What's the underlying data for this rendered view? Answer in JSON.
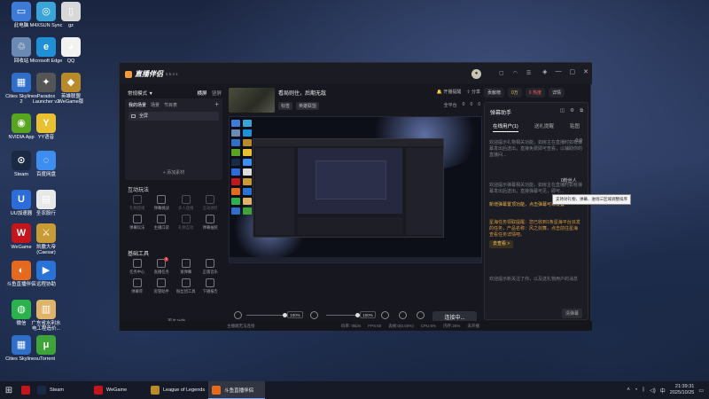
{
  "desktop": {
    "icons": [
      {
        "label": "此电脑",
        "color": "#3d7bd6",
        "glyph": "▭"
      },
      {
        "label": "M4XSUN Sync",
        "color": "#3aa4d8",
        "glyph": "◎"
      },
      {
        "label": "gz",
        "color": "#d8d8d8",
        "glyph": "▯"
      },
      {
        "label": "回收站",
        "color": "#6a8ab3",
        "glyph": "♲"
      },
      {
        "label": "Microsoft Edge",
        "color": "#1f8fd6",
        "glyph": "e"
      },
      {
        "label": "QQ",
        "color": "#f2f2f2",
        "glyph": "◕"
      },
      {
        "label": "Cities Skylines 2",
        "color": "#2f6fc8",
        "glyph": "▦"
      },
      {
        "label": "Paradox Launcher v2",
        "color": "#555",
        "glyph": "✦"
      },
      {
        "label": "英雄联盟 WeGame版",
        "color": "#b88a2a",
        "glyph": "◆"
      },
      {
        "label": "NVIDIA App",
        "color": "#58a520",
        "glyph": "◉"
      },
      {
        "label": "YY语音",
        "color": "#e9c02f",
        "glyph": "Y"
      },
      {
        "label": "Steam",
        "color": "#1b2a44",
        "glyph": "⊙"
      },
      {
        "label": "百度网盘",
        "color": "#3d8ef0",
        "glyph": "◌"
      },
      {
        "label": "UU加速器",
        "color": "#2b6cd9",
        "glyph": "U"
      },
      {
        "label": "圣农股行",
        "color": "#e8e8e8",
        "glyph": "▤"
      },
      {
        "label": "WeGame",
        "color": "#c4141c",
        "glyph": "W"
      },
      {
        "label": "凯撒大帝 (Caesar)",
        "color": "#c99b35",
        "glyph": "⚔"
      },
      {
        "label": "斗鱼直播伴侣",
        "color": "#e56a20",
        "glyph": "◐"
      },
      {
        "label": "远程协助",
        "color": "#2a73d6",
        "glyph": "▶"
      },
      {
        "label": "微信",
        "color": "#2bb24c",
        "glyph": "◍"
      },
      {
        "label": "广东省水利水电工程造价...",
        "color": "#e0b36a",
        "glyph": "▥"
      },
      {
        "label": "Cities Skylines",
        "color": "#2f6fc8",
        "glyph": "▦"
      },
      {
        "label": "uTorrent",
        "color": "#3ea43a",
        "glyph": "μ"
      }
    ]
  },
  "taskbar": {
    "start_icon": "windows-icon",
    "items": [
      {
        "label": "",
        "color": "#c4141c"
      },
      {
        "label": "Steam",
        "color": "#1b2a44"
      },
      {
        "label": "WeGame",
        "color": "#c4141c"
      },
      {
        "label": "League of Legends",
        "color": "#b88a2a"
      },
      {
        "label": "斗鱼直播伴侣",
        "color": "#e56a20"
      }
    ],
    "active_index": 4,
    "tray": {
      "time": "21:39:31",
      "date": "2025/10/25",
      "lang": "中"
    }
  },
  "app": {
    "logo_text": "直播伴侣",
    "version": "6.5.2.1",
    "avatar_text": "●",
    "left": {
      "mode_label": "常规模式",
      "mode_arrow": "▼",
      "tabs": [
        "横屏",
        "竖屏"
      ],
      "scene_tabs": [
        "我的场景",
        "场景",
        "节目表"
      ],
      "scene_item": "全屏",
      "add_source": "+ 添加素材",
      "interactive_title": "互动玩法",
      "interactive_tools": [
        {
          "label": "礼物连线",
          "dim": true
        },
        {
          "label": "弹幕挑战",
          "dim": false
        },
        {
          "label": "多人连线",
          "dim": true
        },
        {
          "label": "互动进阶",
          "dim": true
        },
        {
          "label": "弹幕玩法",
          "dim": false
        },
        {
          "label": "主播口袋",
          "dim": false
        },
        {
          "label": "礼物互动",
          "dim": true
        },
        {
          "label": "弹幕抽奖",
          "dim": false
        }
      ],
      "basic_title": "基础工具",
      "basic_tools": [
        {
          "label": "任务中心",
          "badge": ""
        },
        {
          "label": "直播任务",
          "badge": "1"
        },
        {
          "label": "速弹幕",
          "badge": ""
        },
        {
          "label": "正版音乐",
          "badge": ""
        },
        {
          "label": "弹幕库",
          "badge": ""
        },
        {
          "label": "房管助手",
          "badge": ""
        },
        {
          "label": "粉丝团工具",
          "badge": ""
        },
        {
          "label": "下播报告",
          "badge": ""
        }
      ],
      "more": "⋯ 更多功能"
    },
    "center": {
      "room_title": "看局则住，后期无敌",
      "room_tag": "标签",
      "room_category": "英雄联盟",
      "actions": [
        "开播提醒",
        "分享"
      ],
      "mode_btn": "全平台",
      "stats": [
        "0",
        "0",
        "0"
      ],
      "controls": {
        "mic_label": "麦克风",
        "mic_pct": "100%",
        "speaker_label": "扬声器",
        "speaker_pct": "100%",
        "tool_labels": [
          "美颜",
          "录制",
          "设置"
        ],
        "live_btn": "连接中..."
      }
    },
    "status": {
      "left": "主播端无法连接",
      "items": [
        "码率: 0kb/s",
        "FPS:60",
        "丢帧:0(0.00%)",
        "CPU:6%",
        "内存:25%",
        "未开播"
      ]
    },
    "right": {
      "top_pills": [
        "贡献榜",
        "0万",
        "0 热度",
        "详情"
      ],
      "danmu_title": "弹幕助手",
      "danmu_tabs": [
        "在线用户(1)",
        "送礼提醒",
        "贴图"
      ],
      "count": "0.0",
      "tip1": "欢迎提示礼物相关功能，如房主在直播时如有弹幕发出后送出，直接免费即可查看，以辅助你的直播间...",
      "tip2": "欢迎提示弹幕相关功能，如房主在直播时如有弹幕发出后送出，直接弹幕可见，即可...",
      "notice1": "新增弹幕置顶功能，点击弹幕可以设置",
      "notice2": "星海任务领取提醒：您已收到1条星海平台派发的任务，产品名称：风之剑舞，点击前往星海查看任务详情吧。",
      "go_btn": "去查看 >",
      "tip3": "欢迎提示新关注了你，以及送礼物用户的消息",
      "clear_btn": "清弹幕"
    },
    "tooltip": "支持对礼物、弹幕、进场三区域调整排序",
    "fans_label": "0粉丝人"
  }
}
